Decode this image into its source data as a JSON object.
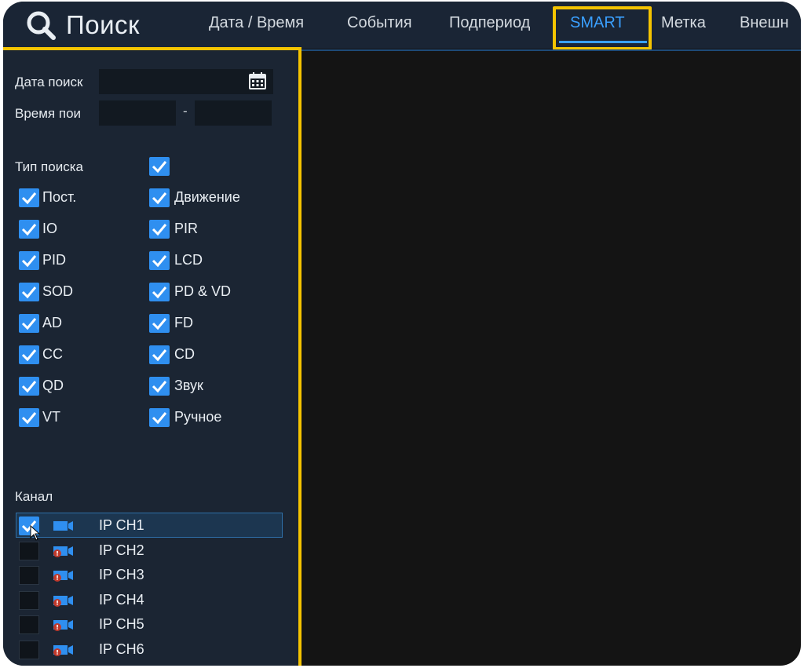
{
  "header": {
    "title": "Поиск",
    "tabs": [
      {
        "label": "Дата / Время",
        "active": false
      },
      {
        "label": "События",
        "active": false
      },
      {
        "label": "Подпериод",
        "active": false
      },
      {
        "label": "SMART",
        "active": true
      },
      {
        "label": "Метка",
        "active": false
      },
      {
        "label": "Внешн",
        "active": false
      }
    ]
  },
  "search": {
    "date_label": "Дата поиск",
    "time_label": "Время пои",
    "time_separator": "-",
    "type_label": "Тип поиска",
    "type_all_checked": true,
    "types_left": [
      {
        "label": "Пост.",
        "checked": true
      },
      {
        "label": "IO",
        "checked": true
      },
      {
        "label": "PID",
        "checked": true
      },
      {
        "label": "SOD",
        "checked": true
      },
      {
        "label": "AD",
        "checked": true
      },
      {
        "label": "CC",
        "checked": true
      },
      {
        "label": "QD",
        "checked": true
      },
      {
        "label": "VT",
        "checked": true
      }
    ],
    "types_right": [
      {
        "label": "Движение",
        "checked": true
      },
      {
        "label": "PIR",
        "checked": true
      },
      {
        "label": "LCD",
        "checked": true
      },
      {
        "label": "PD & VD",
        "checked": true
      },
      {
        "label": "FD",
        "checked": true
      },
      {
        "label": "CD",
        "checked": true
      },
      {
        "label": "Звук",
        "checked": true
      },
      {
        "label": "Ручное",
        "checked": true
      }
    ]
  },
  "channels": {
    "label": "Канал",
    "items": [
      {
        "label": "IP CH1",
        "checked": true,
        "online": true
      },
      {
        "label": "IP CH2",
        "checked": false,
        "online": false
      },
      {
        "label": "IP CH3",
        "checked": false,
        "online": false
      },
      {
        "label": "IP CH4",
        "checked": false,
        "online": false
      },
      {
        "label": "IP CH5",
        "checked": false,
        "online": false
      },
      {
        "label": "IP CH6",
        "checked": false,
        "online": false
      }
    ]
  },
  "colors": {
    "accent": "#3aa0ff",
    "highlight": "#f5c400",
    "checkbox": "#2f8ff0",
    "offline": "#c0392b"
  }
}
